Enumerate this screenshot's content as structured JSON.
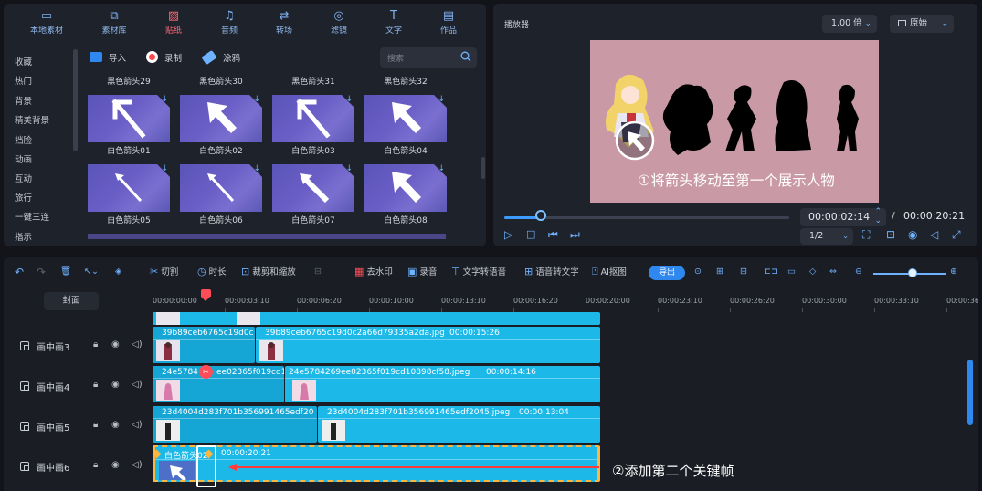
{
  "media_tabs": [
    {
      "label": "本地素材",
      "icon": "folder-icon",
      "active": false
    },
    {
      "label": "素材库",
      "icon": "library-icon",
      "active": false
    },
    {
      "label": "贴纸",
      "icon": "sticker-icon",
      "active": true
    },
    {
      "label": "音频",
      "icon": "music-icon",
      "active": false
    },
    {
      "label": "转场",
      "icon": "transition-icon",
      "active": false
    },
    {
      "label": "滤镜",
      "icon": "filter-icon",
      "active": false
    },
    {
      "label": "文字",
      "icon": "text-icon",
      "active": false
    },
    {
      "label": "作品",
      "icon": "works-icon",
      "active": false
    }
  ],
  "categories": [
    "收藏",
    "热门",
    "背景",
    "精美背景",
    "挡脸",
    "动画",
    "互动",
    "旅行",
    "一键三连",
    "指示"
  ],
  "media_tools": {
    "import": "导入",
    "record": "录制",
    "doodle": "涂鸦",
    "search_placeholder": "搜索"
  },
  "top_row_labels": [
    "黑色箭头29",
    "黑色箭头30",
    "黑色箭头31",
    "黑色箭头32"
  ],
  "thumbnails": [
    {
      "label": "白色箭头01",
      "arrow": "thin-diag"
    },
    {
      "label": "白色箭头02",
      "arrow": "cursor"
    },
    {
      "label": "白色箭头03",
      "arrow": "thin-diag"
    },
    {
      "label": "白色箭头04",
      "arrow": "cursor"
    },
    {
      "label": "白色箭头05",
      "arrow": "line"
    },
    {
      "label": "白色箭头06",
      "arrow": "line"
    },
    {
      "label": "白色箭头07",
      "arrow": "bold"
    },
    {
      "label": "白色箭头08",
      "arrow": "cursor"
    }
  ],
  "player": {
    "title": "播放器",
    "speed": "1.00 倍",
    "ratio_mode": "原始",
    "caption": "①将箭头移动至第一个展示人物",
    "current_time": "00:00:02:14",
    "separator": "/",
    "total_time": "00:00:20:21",
    "quality": "1/2",
    "progress": 0.12
  },
  "toolbar": {
    "cut": "切割",
    "duration": "时长",
    "crop_zoom": "裁剪和缩放",
    "watermark": "去水印",
    "record": "录音",
    "tts": "文字转语音",
    "stt": "语音转文字",
    "ai_matting": "AI抠图",
    "export": "导出"
  },
  "timeline": {
    "cover": "封面",
    "ruler": [
      "00:00:00:00",
      "00:00:03:10",
      "00:00:06:20",
      "00:00:10:00",
      "00:00:13:10",
      "00:00:16:20",
      "00:00:20:00",
      "00:00:23:10",
      "00:00:26:20",
      "00:00:30:00",
      "00:00:33:10",
      "00:00:36"
    ],
    "tracks": [
      {
        "name": "画中画3",
        "clip_a": "39b89ceb6765c19d0c",
        "clip_b": "39b89ceb6765c19d0c2a66d79335a2da.jpg",
        "duration": "00:00:15:26"
      },
      {
        "name": "画中画4",
        "clip_a": "24e5784",
        "clip_a2": "ee02365f019cd1",
        "clip_b": "24e5784269ee02365f019cd10898cf58.jpeg",
        "duration": "00:00:14:16"
      },
      {
        "name": "画中画5",
        "clip_a": "23d4004d283f701b356991465edf20",
        "clip_b": "23d4004d283f701b356991465edf2045.jpeg",
        "duration": "00:00:13:04"
      },
      {
        "name": "画中画6",
        "clip_a": "白色箭头02",
        "clip_b": "",
        "duration": "00:00:20:21"
      }
    ],
    "caption": "②添加第二个关键帧"
  },
  "colors": {
    "accent": "#2f87f0",
    "clip": "#1cb8e8",
    "playhead": "#ff4d57",
    "active_tab": "#ff6a75"
  }
}
